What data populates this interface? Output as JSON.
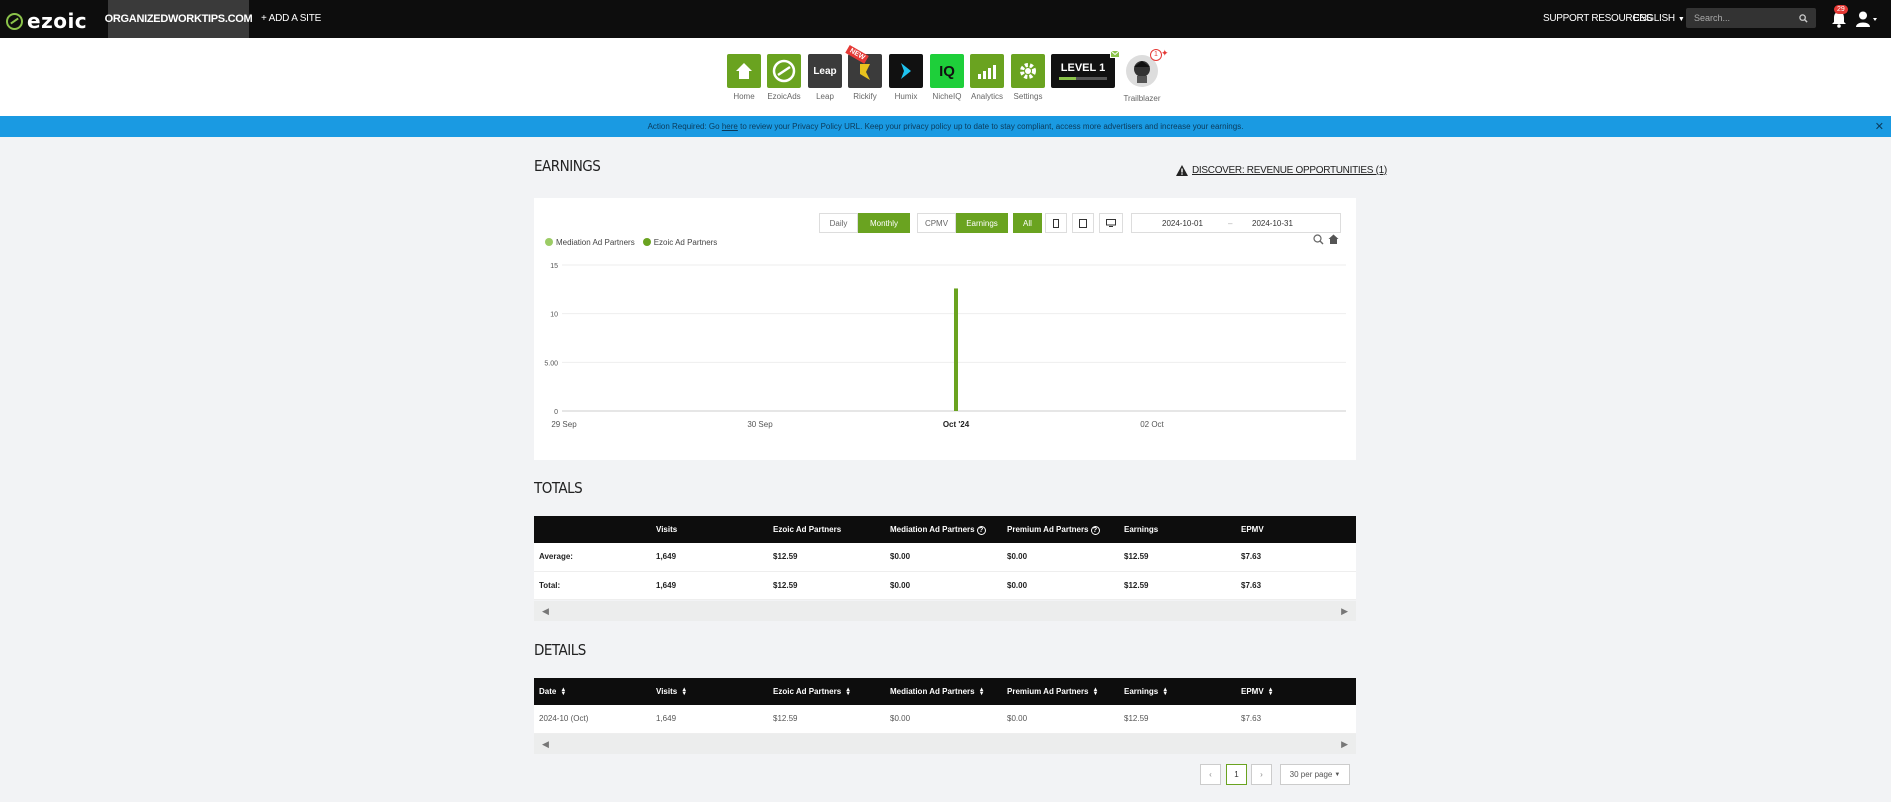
{
  "topbar": {
    "logo": "ezoic",
    "site": "ORGANIZEDWORKTIPS.COM",
    "add_site": "+ ADD A SITE",
    "support": "SUPPORT RESOURCES",
    "language": "ENGLISH",
    "search_placeholder": "Search...",
    "notifications": "29"
  },
  "apps": [
    {
      "label": "Home",
      "color": "#6aa320",
      "icon": "home-icon"
    },
    {
      "label": "EzoicAds",
      "color": "#6aa320",
      "icon": "ezoicads-icon"
    },
    {
      "label": "Leap",
      "color": "#3b3b3b",
      "icon": "leap-icon",
      "glyph": "Leap"
    },
    {
      "label": "Rickify",
      "color": "#3b3b3b",
      "icon": "rickify-icon",
      "tag": "NEW"
    },
    {
      "label": "Humix",
      "color": "#111111",
      "icon": "humix-icon"
    },
    {
      "label": "NicheIQ",
      "color": "#1ecf3a",
      "icon": "nicheiq-icon",
      "glyph": "IQ"
    },
    {
      "label": "Analytics",
      "color": "#6aa320",
      "icon": "analytics-icon"
    },
    {
      "label": "Settings",
      "color": "#6aa320",
      "icon": "gear-icon"
    }
  ],
  "level": {
    "label": "LEVEL 1",
    "progress": 0.35
  },
  "trailblazer": {
    "label": "Trailblazer",
    "count": "1"
  },
  "alert": {
    "prefix": "Action Required: Go",
    "link": "here",
    "suffix": "to review your Privacy Policy URL. Keep your privacy policy up to date to stay compliant, access more advertisers and increase your earnings."
  },
  "earnings": {
    "title": "EARNINGS",
    "discover": "DISCOVER: REVENUE OPPORTUNITIES (1)",
    "buttons": {
      "daily": "Daily",
      "monthly": "Monthly",
      "cpmv": "CPMV",
      "earnings": "Earnings",
      "all": "All"
    },
    "date_from": "2024-10-01",
    "date_sep": "–",
    "date_to": "2024-10-31"
  },
  "chart_data": {
    "type": "bar",
    "legend": [
      "Mediation Ad Partners",
      "Ezoic Ad Partners"
    ],
    "colors": {
      "Mediation Ad Partners": "#9ccc65",
      "Ezoic Ad Partners": "#6aa320"
    },
    "y_ticks": [
      "0",
      "5.00",
      "10",
      "15"
    ],
    "ylim": [
      0,
      15
    ],
    "x_ticks": [
      "29 Sep",
      "30 Sep",
      "Oct '24",
      "02 Oct"
    ],
    "series": [
      {
        "name": "Mediation Ad Partners",
        "x": [
          "Oct '24"
        ],
        "values": [
          0
        ]
      },
      {
        "name": "Ezoic Ad Partners",
        "x": [
          "Oct '24"
        ],
        "values": [
          12.59
        ]
      }
    ],
    "legend_position": "top-left",
    "grid": true
  },
  "totals": {
    "title": "TOTALS",
    "columns": [
      "",
      "Visits",
      "Ezoic Ad Partners",
      "Mediation Ad Partners",
      "Premium Ad Partners",
      "Earnings",
      "EPMV"
    ],
    "rows": [
      [
        "Average:",
        "1,649",
        "$12.59",
        "$0.00",
        "$0.00",
        "$12.59",
        "$7.63"
      ],
      [
        "Total:",
        "1,649",
        "$12.59",
        "$0.00",
        "$0.00",
        "$12.59",
        "$7.63"
      ]
    ]
  },
  "details": {
    "title": "DETAILS",
    "columns": [
      "Date",
      "Visits",
      "Ezoic Ad Partners",
      "Mediation Ad Partners",
      "Premium Ad Partners",
      "Earnings",
      "EPMV"
    ],
    "rows": [
      [
        "2024-10 (Oct)",
        "1,649",
        "$12.59",
        "$0.00",
        "$0.00",
        "$12.59",
        "$7.63"
      ]
    ]
  },
  "pager": {
    "prev": "‹",
    "page": "1",
    "next": "›",
    "per_page": "30 per page"
  }
}
